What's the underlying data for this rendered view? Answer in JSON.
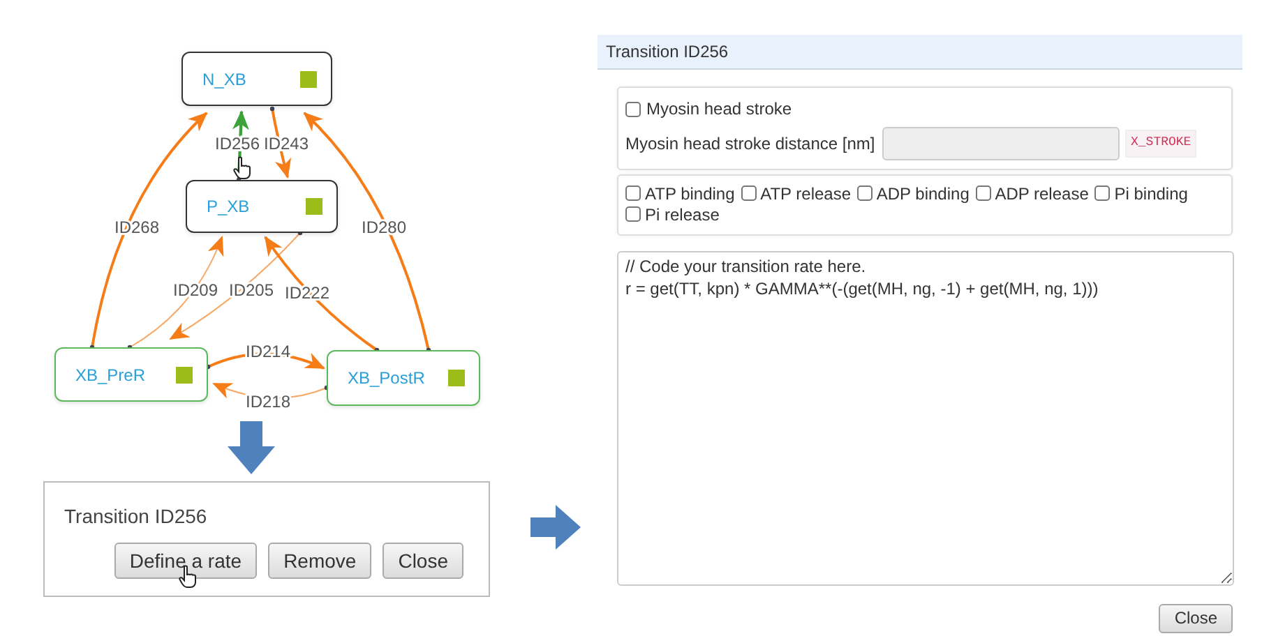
{
  "diagram": {
    "nodes": [
      {
        "label": "N_XB",
        "color": "#333333"
      },
      {
        "label": "P_XB",
        "color": "#333333"
      },
      {
        "label": "XB_PreR",
        "color": "#5cb85c"
      },
      {
        "label": "XB_PostR",
        "color": "#5cb85c"
      }
    ],
    "edges": [
      {
        "label": "ID256",
        "selected": true,
        "kind": "thick"
      },
      {
        "label": "ID243",
        "selected": false,
        "kind": "thick"
      },
      {
        "label": "ID268",
        "selected": false,
        "kind": "thick"
      },
      {
        "label": "ID280",
        "selected": false,
        "kind": "thick"
      },
      {
        "label": "ID209",
        "selected": false,
        "kind": "thin"
      },
      {
        "label": "ID205",
        "selected": false,
        "kind": "thin"
      },
      {
        "label": "ID222",
        "selected": false,
        "kind": "thick"
      },
      {
        "label": "ID214",
        "selected": false,
        "kind": "thick"
      },
      {
        "label": "ID218",
        "selected": false,
        "kind": "thin"
      }
    ]
  },
  "popup": {
    "title": "Transition ID256",
    "buttons": [
      "Define a rate",
      "Remove",
      "Close"
    ]
  },
  "dialog": {
    "title": "Transition ID256",
    "stroke": {
      "label": "Myosin head stroke",
      "checked": false
    },
    "distance": {
      "label": "Myosin head stroke distance [nm]",
      "disabled": true
    },
    "badge": "X_STROKE",
    "events": [
      {
        "label": "ATP binding",
        "checked": false
      },
      {
        "label": "ATP release",
        "checked": false
      },
      {
        "label": "ADP binding",
        "checked": false
      },
      {
        "label": "ADP release",
        "checked": false
      },
      {
        "label": "Pi binding",
        "checked": false
      },
      {
        "label": "Pi release",
        "checked": false
      }
    ],
    "code": [
      "// Code your transition rate here.",
      "r = get(TT, kpn) * GAMMA**(-(get(MH, ng, -1) + get(MH, ng, 1)))"
    ],
    "close": "Close"
  }
}
